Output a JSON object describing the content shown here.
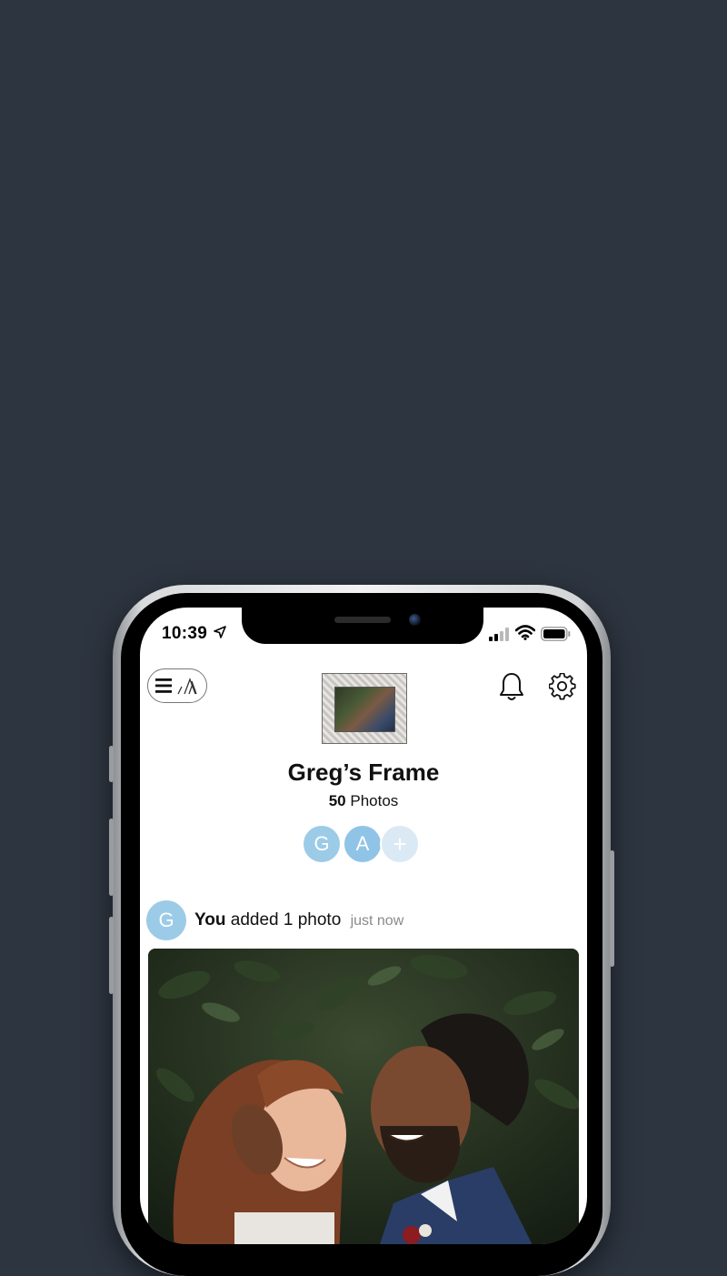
{
  "status_bar": {
    "time": "10:39"
  },
  "header": {
    "menu_icon": "hamburger-menu-icon",
    "logo_icon": "app-logo-icon",
    "notifications_icon": "bell-icon",
    "settings_icon": "gear-icon"
  },
  "frame": {
    "title": "Greg’s Frame",
    "photo_count": "50",
    "photo_count_label": "Photos"
  },
  "members": [
    {
      "initial": "G",
      "color": "#9ccbe8"
    },
    {
      "initial": "A",
      "color": "#8fc4e6"
    }
  ],
  "add_member_label": "+",
  "feed": {
    "avatar_initial": "G",
    "actor": "You",
    "action": "added 1 photo",
    "time": "just now"
  },
  "colors": {
    "background": "#2d3540",
    "avatar_blue": "#9ccbe8",
    "add_avatar": "#dbe9f5"
  }
}
